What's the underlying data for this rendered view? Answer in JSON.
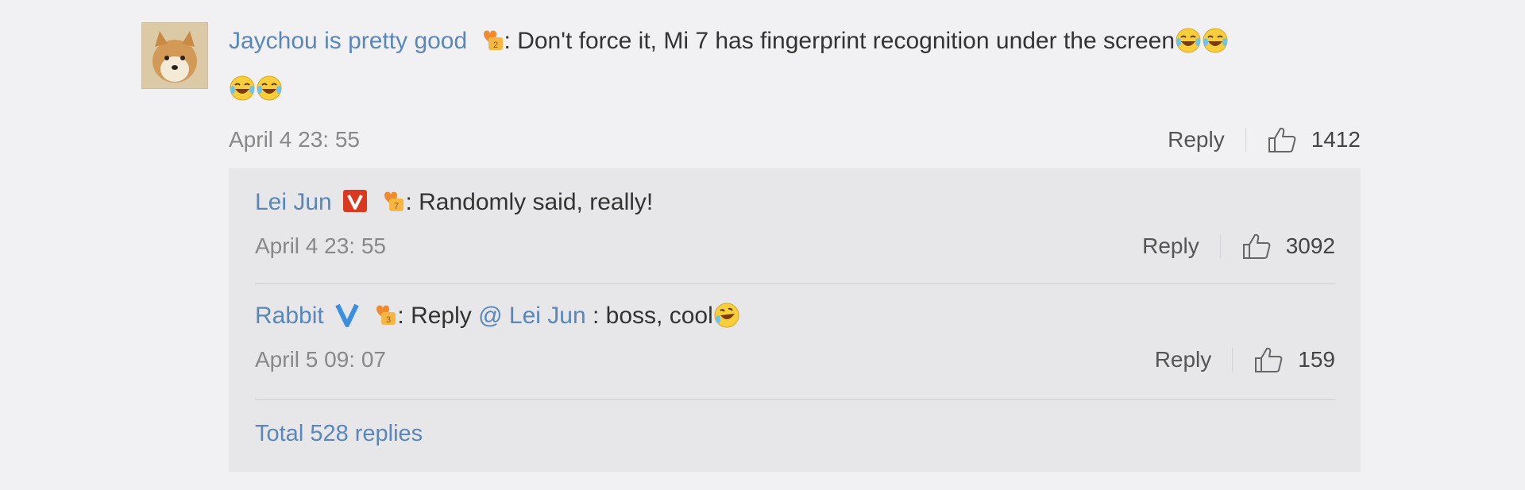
{
  "main_comment": {
    "username": "Jaychou is pretty good",
    "text": ": Don't force it, Mi 7 has fingerprint recognition under the screen",
    "timestamp": "April 4 23: 55",
    "reply_label": "Reply",
    "likes": "1412"
  },
  "replies": [
    {
      "username": "Lei Jun",
      "text": ": Randomly said, really!",
      "timestamp": "April 4 23: 55",
      "reply_label": "Reply",
      "likes": "3092"
    },
    {
      "username": "Rabbit",
      "text_prefix": ": Reply ",
      "mention": "@ Lei Jun",
      "text_suffix": " : boss, cool",
      "timestamp": "April 5 09: 07",
      "reply_label": "Reply",
      "likes": "159"
    }
  ],
  "total_replies_label": "Total 528 replies",
  "colors": {
    "link": "#5a87b8",
    "background": "#f1f1f4",
    "reply_box": "#e7e7ea",
    "verified_red": "#d9391e",
    "verified_blue": "#3a8fe0"
  }
}
